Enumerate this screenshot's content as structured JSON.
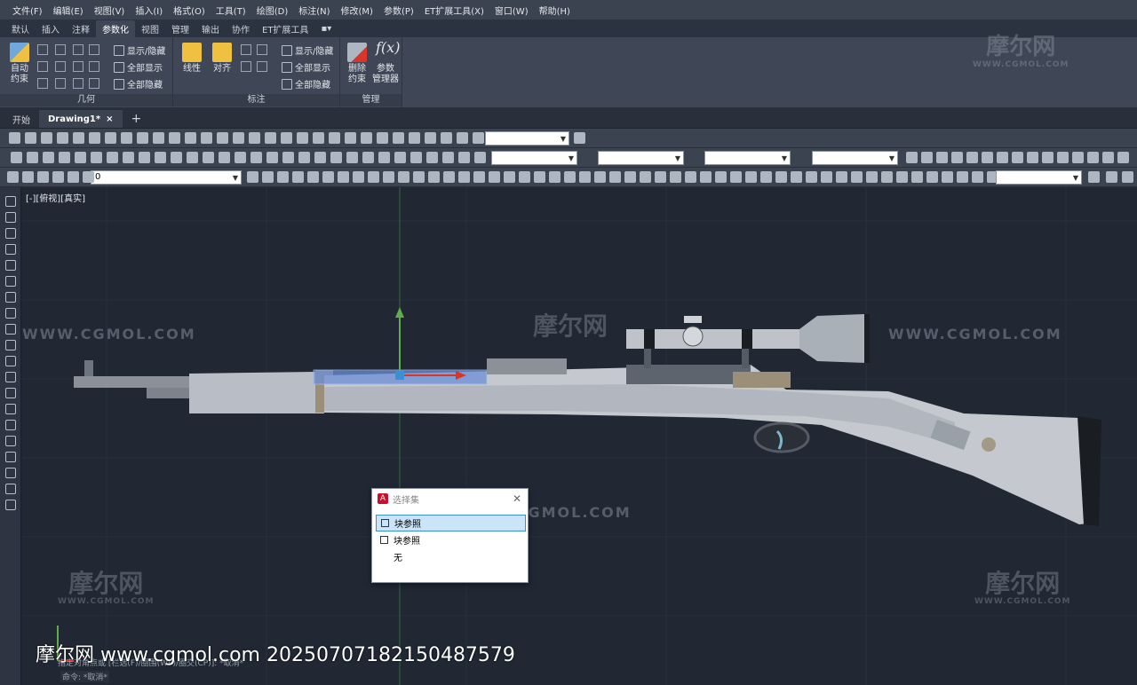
{
  "menu": [
    "文件(F)",
    "编辑(E)",
    "视图(V)",
    "插入(I)",
    "格式(O)",
    "工具(T)",
    "绘图(D)",
    "标注(N)",
    "修改(M)",
    "参数(P)",
    "ET扩展工具(X)",
    "窗口(W)",
    "帮助(H)"
  ],
  "ribbon_tabs": [
    {
      "label": "默认",
      "active": false
    },
    {
      "label": "插入",
      "active": false
    },
    {
      "label": "注释",
      "active": false
    },
    {
      "label": "参数化",
      "active": true
    },
    {
      "label": "视图",
      "active": false
    },
    {
      "label": "管理",
      "active": false
    },
    {
      "label": "输出",
      "active": false
    },
    {
      "label": "协作",
      "active": false
    },
    {
      "label": "ET扩展工具",
      "active": false
    }
  ],
  "ribbon": {
    "geometry": {
      "auto_constrain": "自动\n约束",
      "show_hide": "显示/隐藏",
      "show_all": "全部显示",
      "hide_all": "全部隐藏",
      "title": "几何"
    },
    "dimension": {
      "linear": "线性",
      "aligned": "对齐",
      "show_hide": "显示/隐藏",
      "show_all": "全部显示",
      "hide_all": "全部隐藏",
      "title": "标注"
    },
    "manage": {
      "delete_constraints": "删除\n约束",
      "param_manager": "参数\n管理器",
      "title": "管理",
      "fx": "f(x)"
    }
  },
  "doc_tabs": {
    "start": "开始",
    "drawing": "Drawing1*",
    "close": "×",
    "add": "+"
  },
  "layer_combo": {
    "value": "0"
  },
  "viewport": {
    "label": "[-][俯视][真实]",
    "watermark_url": "WWW.CGMOL.COM",
    "watermark_logo": "摩尔网",
    "watermark_logo_small": "WWW.CGMOL.COM"
  },
  "selection_dialog": {
    "title": "选择集",
    "items": [
      {
        "label": "块参照",
        "checkbox": true,
        "selected": true
      },
      {
        "label": "块参照",
        "checkbox": true,
        "selected": false
      },
      {
        "label": "无",
        "checkbox": false,
        "selected": false
      }
    ]
  },
  "command": {
    "prev": "指定对角点或 [栏选(F)/圈围(WP)/圈交(CP)]: *取消*",
    "current": "命令: *取消*"
  },
  "overlay_text": "摩尔网 www.cgmol.com 20250707182150487579",
  "colors": {
    "viewport_bg": "#212834",
    "accent": "#3b8fd6",
    "brand_red": "#c8102e"
  }
}
